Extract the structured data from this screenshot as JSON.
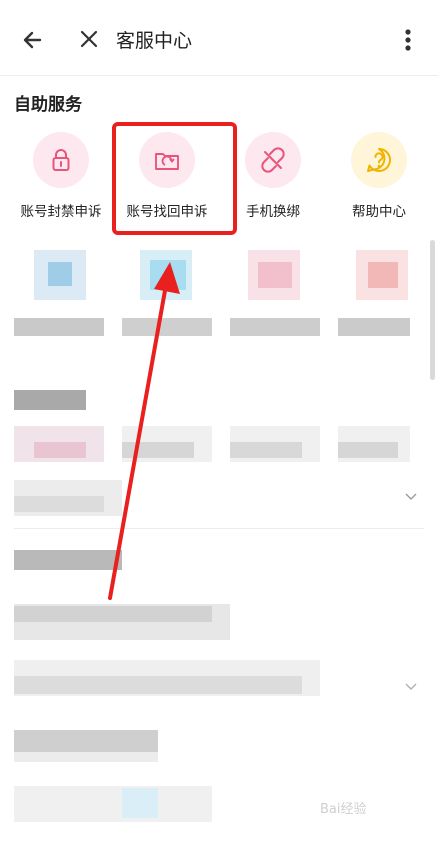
{
  "header": {
    "title": "客服中心",
    "back_icon": "arrow-left-icon",
    "close_icon": "close-icon",
    "more_icon": "more-vertical-icon"
  },
  "self_service": {
    "title": "自助服务",
    "items": [
      {
        "label": "账号封禁申诉",
        "icon": "lock-icon",
        "color": "#e9557a",
        "bg": "#fde8ef"
      },
      {
        "label": "账号找回申诉",
        "icon": "folder-refresh-icon",
        "color": "#e9557a",
        "bg": "#fde8ef"
      },
      {
        "label": "手机换绑",
        "icon": "unlink-icon",
        "color": "#e9557a",
        "bg": "#fde8ef"
      },
      {
        "label": "帮助中心",
        "icon": "help-bubble-icon",
        "color": "#f0b400",
        "bg": "#fff5d9"
      }
    ]
  },
  "annotation": {
    "highlight_color": "#e8201e"
  },
  "watermark": "Bai经验"
}
